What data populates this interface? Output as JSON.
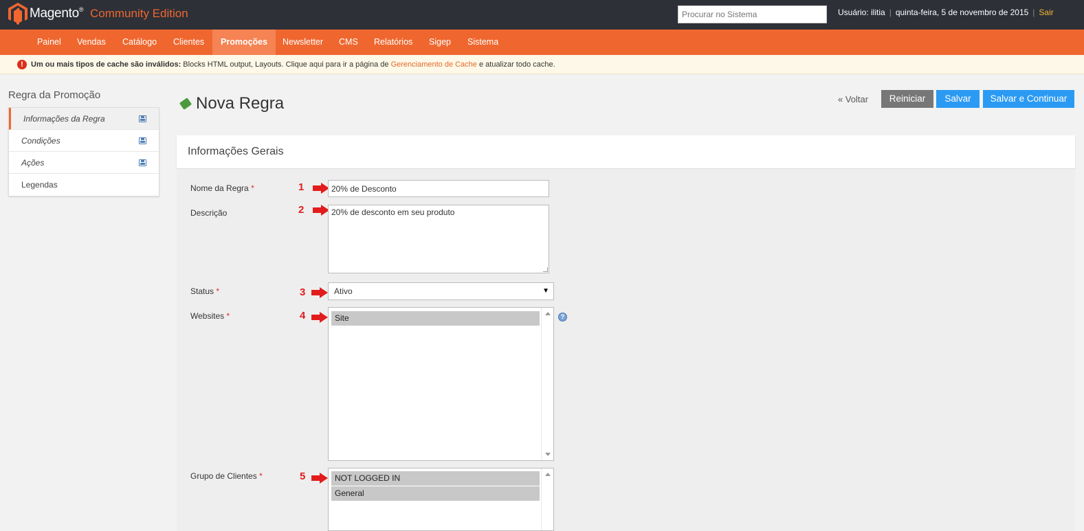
{
  "header": {
    "brand": "Magento",
    "edition": "Community Edition",
    "search_placeholder": "Procurar no Sistema",
    "user": "Usuário: ilitia",
    "date": "quinta-feira, 5 de novembro de 2015",
    "logout": "Sair"
  },
  "nav": {
    "items": [
      "Painel",
      "Vendas",
      "Catálogo",
      "Clientes",
      "Promoções",
      "Newsletter",
      "CMS",
      "Relatórios",
      "Sigep",
      "Sistema"
    ],
    "active": "Promoções"
  },
  "message": {
    "bold": "Um ou mais tipos de cache são inválidos:",
    "text1": " Blocks HTML output, Layouts. Clique aqui para ir a página de ",
    "link": "Gerenciamento de Cache",
    "text2": " e atualizar todo cache."
  },
  "sidebar": {
    "title": "Regra da Promoção",
    "items": [
      "Informações da Regra",
      "Condições",
      "Ações",
      "Legendas"
    ]
  },
  "page": {
    "title": "Nova Regra",
    "back": "« Voltar",
    "reset": "Reiniciar",
    "save": "Salvar",
    "save_continue": "Salvar e Continuar"
  },
  "section": {
    "title": "Informações Gerais"
  },
  "form": {
    "rule_name_label": "Nome da Regra",
    "rule_name_value": "20% de Desconto",
    "description_label": "Descrição",
    "description_value": "20% de desconto em seu produto",
    "status_label": "Status",
    "status_value": "Ativo",
    "websites_label": "Websites",
    "websites_options": [
      "Site"
    ],
    "groups_label": "Grupo de Clientes",
    "groups_options": [
      "NOT LOGGED IN",
      "General"
    ],
    "required_mark": "*"
  },
  "annotations": [
    "1",
    "2",
    "3",
    "4",
    "5"
  ]
}
